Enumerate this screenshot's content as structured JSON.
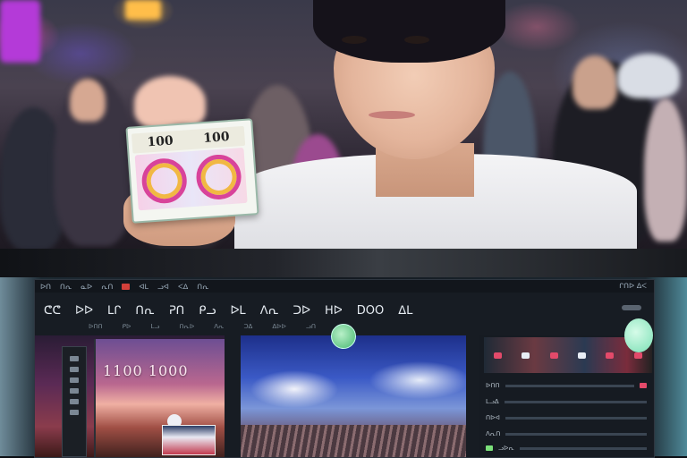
{
  "photo": {
    "card": {
      "label_left": "100",
      "label_right": "100"
    }
  },
  "app": {
    "menubar": {
      "items": [
        "ᐅᑎ",
        "ᑎᕆ",
        "ᓇᐅ",
        "ᕆᑎ",
        "ᐊᒪ",
        "ᓗᐊ",
        "ᐸᐃ",
        "ᑎᕆ"
      ],
      "right": "ᒋᑎᐅ ᐃᐸ"
    },
    "toolbar": {
      "items": [
        "ᕦᕦ",
        "ᐅᐅ",
        "ᒪᒋ",
        "ᑎᕆ",
        "ᕈᑎ",
        "ᑭᓗ",
        "ᐅᒪ",
        "ᐱᕆ",
        "ᑐᐅ",
        "ᕼᐅ",
        "DOO",
        "ᐃᒪ"
      ],
      "sub": [
        "ᐅᑎᑎ",
        "ᑭᐅ",
        "ᒪᓗ",
        "ᑎᕆᐅ",
        "ᐱᕆ",
        "ᑐᐃ",
        "ᐃᐅᐅ",
        "ᓗᑎ"
      ]
    },
    "left_panel": {
      "poster_title": "1100 1000"
    },
    "right_panel": {
      "rows": [
        "ᐅᑎᑎ",
        "ᒪᓗᐃ",
        "ᑎᐅᐊ",
        "ᐱᕆᑎ",
        "ᓗᐅᕆ"
      ]
    }
  },
  "colors": {
    "accent_red": "#d2403a",
    "accent_pink": "#e34a6a",
    "green_dot": "#47b871",
    "mint_dot": "#7be0b5"
  }
}
